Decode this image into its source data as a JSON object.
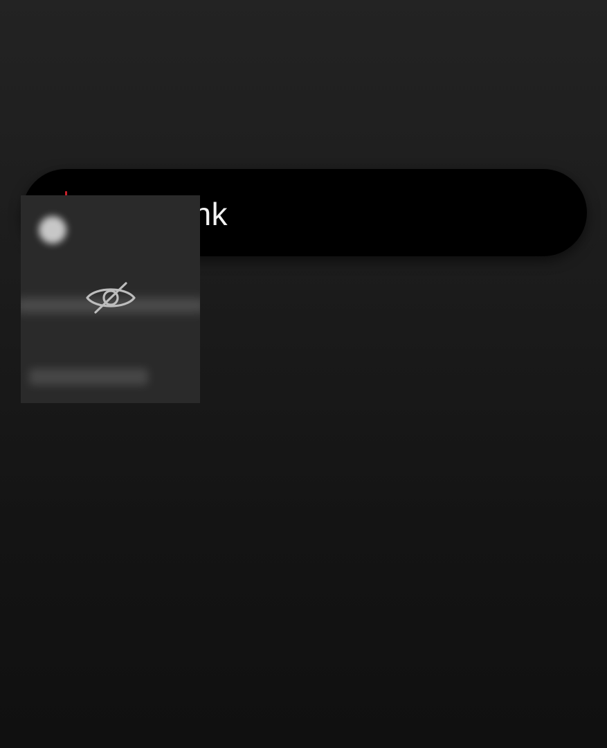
{
  "search": {
    "query_visible": "trial funk"
  },
  "hidden_card": {
    "icon": "eye-off-icon"
  },
  "colors": {
    "background_top": "#232323",
    "background_bottom": "#101010",
    "pill": "#000000",
    "text": "#f2f2f2",
    "card": "#2a2a2a",
    "accent_red": "#c8202a"
  }
}
